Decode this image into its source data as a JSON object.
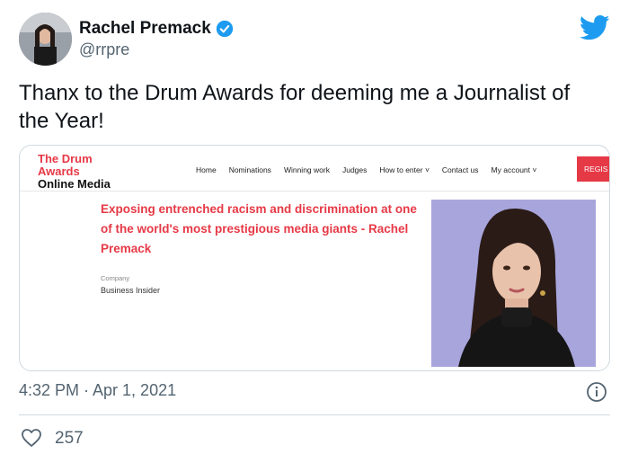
{
  "tweet": {
    "display_name": "Rachel Premack",
    "handle": "@rrpre",
    "text": "Thanx to the Drum Awards for deeming me a Journalist of the Year!",
    "timestamp": "4:32 PM · Apr 1, 2021",
    "like_count": "257",
    "verified": true
  },
  "card": {
    "logo": {
      "line1": "The Drum",
      "line2": "Awards",
      "line3": "Online Media"
    },
    "nav": [
      "Home",
      "Nominations",
      "Winning work",
      "Judges",
      "How to enter ˅",
      "Contact us",
      "My account ˅"
    ],
    "register_label": "REGIS",
    "headline": "Exposing entrenched racism and discrimination at one of the world's most prestigious media giants - Rachel Premack",
    "company_label": "Company",
    "company_value": "Business Insider"
  },
  "colors": {
    "twitter_blue": "#1d9bf0",
    "drum_red": "#e63946",
    "secondary_text": "#536471"
  },
  "icons": [
    "verified-badge-icon",
    "twitter-bird-icon",
    "info-icon",
    "heart-icon"
  ]
}
